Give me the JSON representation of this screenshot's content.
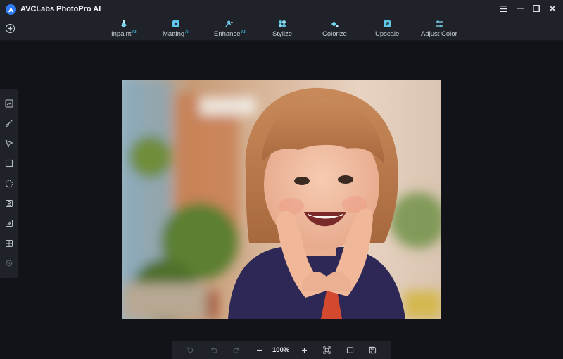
{
  "app": {
    "title": "AVCLabs PhotoPro AI"
  },
  "toolbar": {
    "tools": [
      {
        "label": "Inpaint",
        "badge": "AI"
      },
      {
        "label": "Matting",
        "badge": "AI"
      },
      {
        "label": "Enhance",
        "badge": "AI"
      },
      {
        "label": "Stylize",
        "badge": ""
      },
      {
        "label": "Colorize",
        "badge": ""
      },
      {
        "label": "Upscale",
        "badge": ""
      },
      {
        "label": "Adjust Color",
        "badge": ""
      }
    ]
  },
  "bottombar": {
    "zoom": "100%"
  },
  "colors": {
    "accent": "#2f7cf6",
    "ai_badge": "#39c2e6",
    "panel": "#1f2229",
    "background": "#111318"
  }
}
